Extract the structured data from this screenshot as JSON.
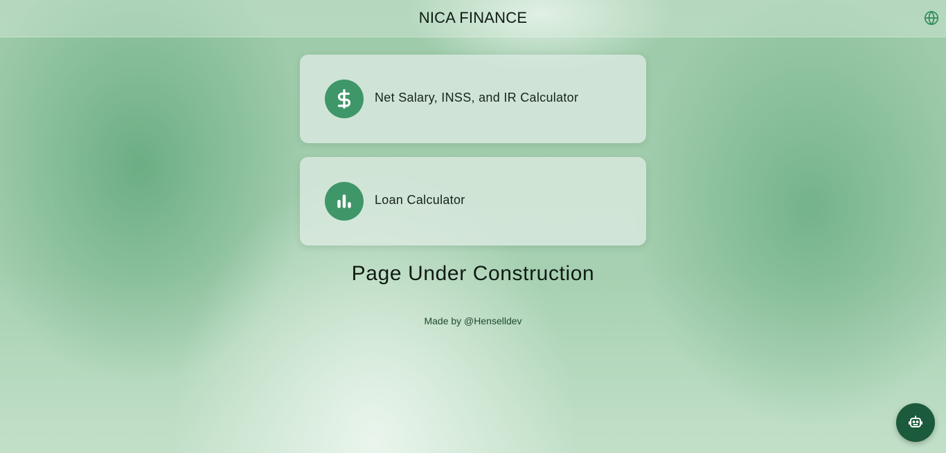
{
  "header": {
    "title": "NICA FINANCE",
    "language_icon": "globe-icon"
  },
  "cards": [
    {
      "label": "Net Salary, INSS, and IR Calculator",
      "icon": "dollar-icon"
    },
    {
      "label": "Loan Calculator",
      "icon": "bar-chart-icon"
    }
  ],
  "main": {
    "heading": "Page Under Construction",
    "credit": "Made by @Henselldev"
  },
  "fab": {
    "icon": "robot-icon"
  },
  "colors": {
    "accent": "#3f9668",
    "fab": "#1b5a3a",
    "globe": "#2f8a5a"
  }
}
